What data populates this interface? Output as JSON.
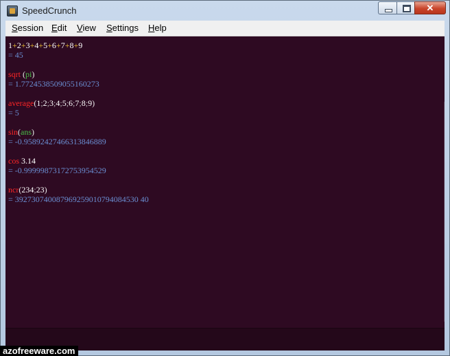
{
  "window": {
    "title": "SpeedCrunch"
  },
  "menubar": {
    "items": [
      {
        "label": "Session",
        "underline": "S",
        "rest": "ession"
      },
      {
        "label": "Edit",
        "underline": "E",
        "rest": "dit"
      },
      {
        "label": "View",
        "underline": "V",
        "rest": "iew"
      },
      {
        "label": "Settings",
        "underline": "S",
        "rest": "ettings"
      },
      {
        "label": "Help",
        "underline": "H",
        "rest": "elp"
      }
    ]
  },
  "history": [
    {
      "expression": "1+2+3+4+5+6+7+8+9",
      "result": "= 45"
    },
    {
      "expression": "sqrt (pi)",
      "result": "= 1.7724538509055160273"
    },
    {
      "expression": "average(1;2;3;4;5;6;7;8;9)",
      "result": "= 5"
    },
    {
      "expression": "sin(ans)",
      "result": "= -0.95892427466313846889"
    },
    {
      "expression": "cos 3.14",
      "result": "= -0.99999873172753954529"
    },
    {
      "expression": "ncr(234;23)",
      "result": "= 392730740087969259010794084530 40"
    }
  ],
  "colors": {
    "background": "#2e0a22",
    "number": "#ffffff",
    "operator": "#f0c232",
    "function": "#ff2626",
    "variable": "#48c048",
    "result": "#6a8ed2"
  },
  "watermark": "azofreeware.com"
}
